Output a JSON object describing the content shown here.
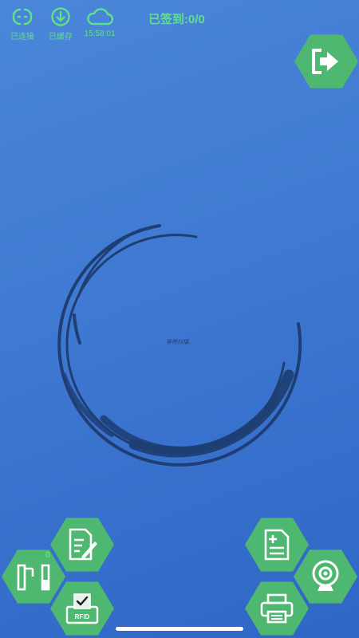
{
  "status_bar": {
    "connected_label": "已连接",
    "cached_label": "已缓存",
    "cloud_time": "15:58:01",
    "checkin_text": "已签到:0/0"
  },
  "scanner": {
    "waiting_text": "等待扫描..."
  },
  "gate_button": {
    "badge_count": "0"
  },
  "rfid_button": {
    "label": "RFID"
  },
  "icons": {
    "connected": "link-icon",
    "cached": "download-icon",
    "cloud": "cloud-icon",
    "logout": "exit-arrow-icon",
    "edit": "document-edit-icon",
    "gate": "turnstile-icon",
    "rfid": "rfid-check-icon",
    "add_doc": "document-add-icon",
    "camera": "webcam-icon",
    "printer": "printer-icon"
  },
  "colors": {
    "accent_green": "#5fe08a",
    "hex_green": "#4fb870",
    "ring_navy": "#1f3f74"
  }
}
